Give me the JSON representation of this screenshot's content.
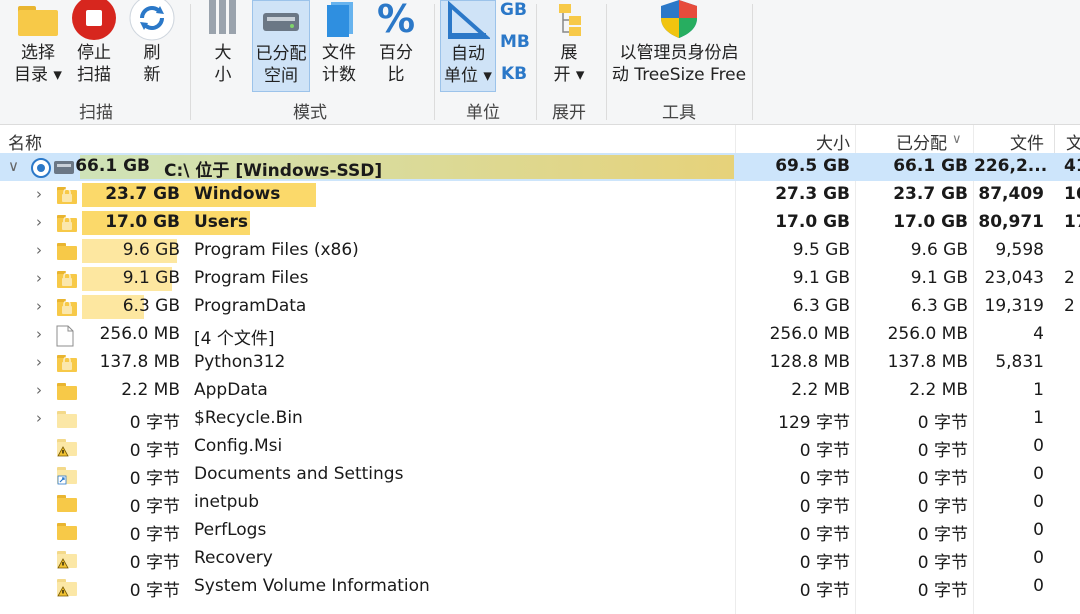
{
  "ribbon": {
    "select_dir": [
      "选择",
      "目录 ▾"
    ],
    "stop_scan": [
      "停止",
      "扫描"
    ],
    "refresh": [
      "刷",
      "新"
    ],
    "group_scan": "扫描",
    "size": [
      "大",
      "小"
    ],
    "allocated": [
      "已分配",
      "空间"
    ],
    "file_count": [
      "文件",
      "计数"
    ],
    "percent": [
      "百分",
      "比"
    ],
    "group_mode": "模式",
    "auto_unit": [
      "自动",
      "单位 ▾"
    ],
    "unit_gb": "GB",
    "unit_mb": "MB",
    "unit_kb": "KB",
    "group_unit": "单位",
    "expand": [
      "展",
      "开 ▾"
    ],
    "group_expand": "展开",
    "admin_restart": [
      "以管理员身份启",
      "动 TreeSize Free"
    ],
    "group_tools": "工具"
  },
  "columns": {
    "name": "名称",
    "size": "大小",
    "allocated": "已分配",
    "sort_indicator": "∨",
    "files": "文件",
    "folders": "文"
  },
  "rows": [
    {
      "size": "66.1 GB",
      "name": "C:\\  位于  [Windows-SSD]",
      "size_col": "69.5 GB",
      "alloc": "66.1 GB",
      "files": "226,2...",
      "folders": "41",
      "bold": true,
      "bar": 1.0,
      "icon": "drive",
      "chev": "∨"
    },
    {
      "size": "23.7 GB",
      "name": "Windows",
      "size_col": "27.3 GB",
      "alloc": "23.7 GB",
      "files": "87,409",
      "folders": "16",
      "bold": true,
      "bar": 0.358,
      "icon": "folder-lock",
      "chev": "›"
    },
    {
      "size": "17.0 GB",
      "name": "Users",
      "size_col": "17.0 GB",
      "alloc": "17.0 GB",
      "files": "80,971",
      "folders": "17",
      "bold": true,
      "bar": 0.257,
      "icon": "folder-lock",
      "chev": "›"
    },
    {
      "size": "9.6 GB",
      "name": "Program Files (x86)",
      "size_col": "9.5 GB",
      "alloc": "9.6 GB",
      "files": "9,598",
      "folders": "",
      "bold": false,
      "bar": 0.145,
      "icon": "folder",
      "chev": "›"
    },
    {
      "size": "9.1 GB",
      "name": "Program Files",
      "size_col": "9.1 GB",
      "alloc": "9.1 GB",
      "files": "23,043",
      "folders": "2",
      "bold": false,
      "bar": 0.138,
      "icon": "folder-lock",
      "chev": "›"
    },
    {
      "size": "6.3 GB",
      "name": "ProgramData",
      "size_col": "6.3 GB",
      "alloc": "6.3 GB",
      "files": "19,319",
      "folders": "2",
      "bold": false,
      "bar": 0.095,
      "icon": "folder-lock",
      "chev": "›"
    },
    {
      "size": "256.0 MB",
      "name": "[4 个文件]",
      "size_col": "256.0 MB",
      "alloc": "256.0 MB",
      "files": "4",
      "folders": "",
      "bold": false,
      "bar": 0,
      "icon": "file",
      "chev": "›"
    },
    {
      "size": "137.8 MB",
      "name": "Python312",
      "size_col": "128.8 MB",
      "alloc": "137.8 MB",
      "files": "5,831",
      "folders": "",
      "bold": false,
      "bar": 0,
      "icon": "folder-lock",
      "chev": "›"
    },
    {
      "size": "2.2 MB",
      "name": "AppData",
      "size_col": "2.2 MB",
      "alloc": "2.2 MB",
      "files": "1",
      "folders": "",
      "bold": false,
      "bar": 0,
      "icon": "folder",
      "chev": "›"
    },
    {
      "size": "0 字节",
      "name": "$Recycle.Bin",
      "size_col": "129 字节",
      "alloc": "0 字节",
      "files": "1",
      "folders": "",
      "bold": false,
      "bar": 0,
      "icon": "folder-light",
      "chev": "›"
    },
    {
      "size": "0 字节",
      "name": "Config.Msi",
      "size_col": "0 字节",
      "alloc": "0 字节",
      "files": "0",
      "folders": "",
      "bold": false,
      "bar": 0,
      "icon": "folder-warn",
      "chev": ""
    },
    {
      "size": "0 字节",
      "name": "Documents and Settings",
      "size_col": "0 字节",
      "alloc": "0 字节",
      "files": "0",
      "folders": "",
      "bold": false,
      "bar": 0,
      "icon": "folder-link",
      "chev": ""
    },
    {
      "size": "0 字节",
      "name": "inetpub",
      "size_col": "0 字节",
      "alloc": "0 字节",
      "files": "0",
      "folders": "",
      "bold": false,
      "bar": 0,
      "icon": "folder",
      "chev": ""
    },
    {
      "size": "0 字节",
      "name": "PerfLogs",
      "size_col": "0 字节",
      "alloc": "0 字节",
      "files": "0",
      "folders": "",
      "bold": false,
      "bar": 0,
      "icon": "folder",
      "chev": ""
    },
    {
      "size": "0 字节",
      "name": "Recovery",
      "size_col": "0 字节",
      "alloc": "0 字节",
      "files": "0",
      "folders": "",
      "bold": false,
      "bar": 0,
      "icon": "folder-warn",
      "chev": ""
    },
    {
      "size": "0 字节",
      "name": "System Volume Information",
      "size_col": "0 字节",
      "alloc": "0 字节",
      "files": "0",
      "folders": "",
      "bold": false,
      "bar": 0,
      "icon": "folder-warn",
      "chev": ""
    }
  ],
  "colors": {
    "bar_root": "#d9d27a",
    "bar": "#fde7a0",
    "bar_strong": "#fbd96a",
    "folder": "#f7c948",
    "accent": "#2b78c8"
  }
}
